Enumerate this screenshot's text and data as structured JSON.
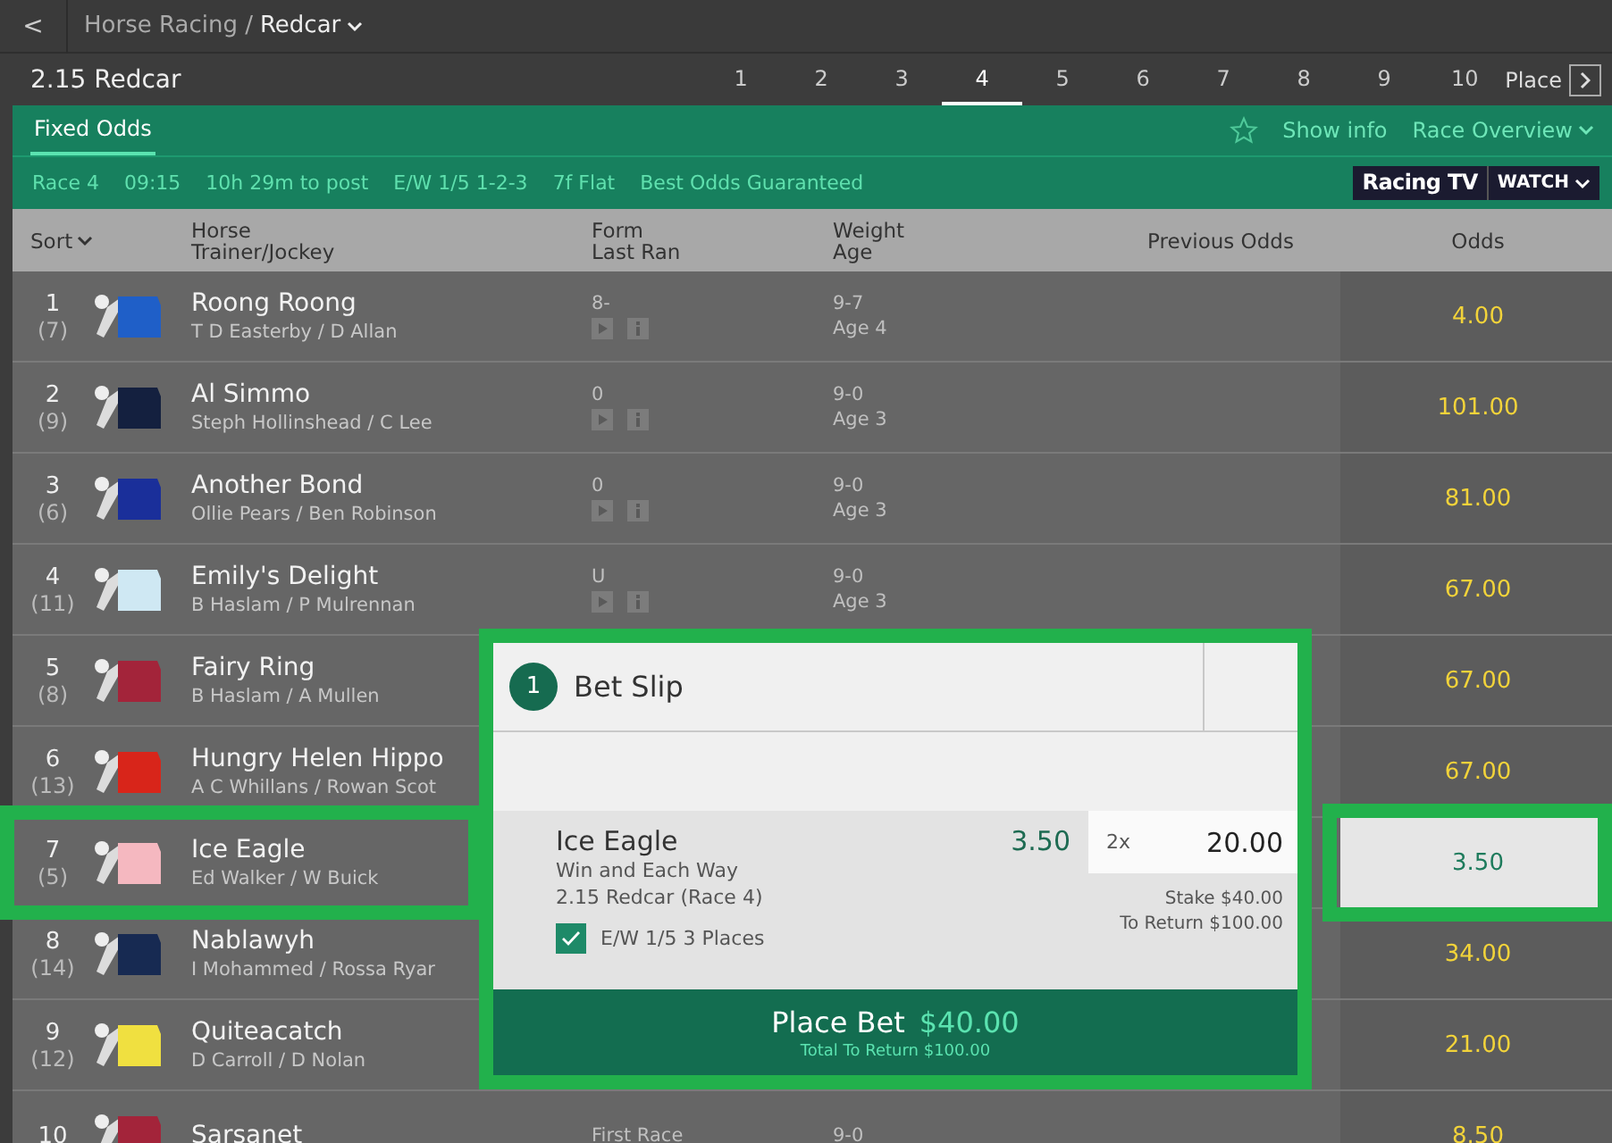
{
  "breadcrumb": {
    "back": "<",
    "section": "Horse Racing",
    "separator": "/",
    "current": "Redcar"
  },
  "race_title": "2.15 Redcar",
  "race_tabs": [
    {
      "label": "1",
      "selected": false
    },
    {
      "label": "2",
      "selected": false
    },
    {
      "label": "3",
      "selected": false
    },
    {
      "label": "4",
      "selected": true
    },
    {
      "label": "5",
      "selected": false
    },
    {
      "label": "6",
      "selected": false
    },
    {
      "label": "7",
      "selected": false
    },
    {
      "label": "8",
      "selected": false
    },
    {
      "label": "9",
      "selected": false
    },
    {
      "label": "10",
      "selected": false
    }
  ],
  "place_label": "Place",
  "market_tabs": [
    {
      "label": "Fixed Odds",
      "selected": true
    }
  ],
  "show_info": "Show info",
  "race_overview": "Race Overview",
  "race_info": [
    "Race 4",
    "09:15",
    "10h 29m to post",
    "E/W 1/5 1-2-3",
    "7f Flat",
    "Best Odds Guaranteed"
  ],
  "racing_tv": "Racing TV",
  "watch": "WATCH",
  "columns": {
    "sort": "Sort",
    "horse": "Horse",
    "trainer_jockey": "Trainer/Jockey",
    "form": "Form",
    "last_ran": "Last Ran",
    "weight": "Weight",
    "age": "Age",
    "previous_odds": "Previous Odds",
    "odds": "Odds"
  },
  "runners": [
    {
      "number": "1",
      "draw": "(7)",
      "name": "Roong Roong",
      "trainer_jockey": "T D Easterby / D Allan",
      "form": "8-",
      "weight": "9-7",
      "age": "Age 4",
      "odds": "4.00",
      "color": "#1f5fc8",
      "selected": false,
      "form_icons": true
    },
    {
      "number": "2",
      "draw": "(9)",
      "name": "Al Simmo",
      "trainer_jockey": "Steph Hollinshead / C Lee",
      "form": "0",
      "weight": "9-0",
      "age": "Age 3",
      "odds": "101.00",
      "color": "#14203f",
      "selected": false,
      "form_icons": true
    },
    {
      "number": "3",
      "draw": "(6)",
      "name": "Another Bond",
      "trainer_jockey": "Ollie Pears / Ben Robinson",
      "form": "0",
      "weight": "9-0",
      "age": "Age 3",
      "odds": "81.00",
      "color": "#1a2f9a",
      "selected": false,
      "form_icons": true
    },
    {
      "number": "4",
      "draw": "(11)",
      "name": "Emily's Delight",
      "trainer_jockey": "B Haslam / P Mulrennan",
      "form": "U",
      "weight": "9-0",
      "age": "Age 3",
      "odds": "67.00",
      "color": "#cfe8f3",
      "selected": false,
      "form_icons": true
    },
    {
      "number": "5",
      "draw": "(8)",
      "name": "Fairy Ring",
      "trainer_jockey": "B Haslam / A Mullen",
      "odds": "67.00",
      "color": "#a3243a",
      "selected": false,
      "form_icons": false
    },
    {
      "number": "6",
      "draw": "(13)",
      "name": "Hungry Helen Hippo",
      "trainer_jockey": "A C Whillans / Rowan Scot",
      "odds": "67.00",
      "color": "#d8251a",
      "selected": false,
      "form_icons": false
    },
    {
      "number": "7",
      "draw": "(5)",
      "name": "Ice Eagle",
      "trainer_jockey": "Ed Walker / W Buick",
      "odds": "3.50",
      "color": "#f5b8c0",
      "selected": true,
      "form_icons": false
    },
    {
      "number": "8",
      "draw": "(14)",
      "name": "Nablawyh",
      "trainer_jockey": "I Mohammed / Rossa Ryar",
      "odds": "34.00",
      "color": "#172a52",
      "selected": false,
      "form_icons": false
    },
    {
      "number": "9",
      "draw": "(12)",
      "name": "Quiteacatch",
      "trainer_jockey": "D Carroll / D Nolan",
      "odds": "21.00",
      "color": "#f0e040",
      "selected": false,
      "form_icons": false
    },
    {
      "number": "10",
      "name": "Sarsanet",
      "form": "First Race",
      "weight": "9-0",
      "odds": "8.50",
      "color": "#a3243a",
      "selected": false,
      "form_icons": false
    }
  ],
  "bet_slip": {
    "count": "1",
    "title": "Bet Slip",
    "selection": "Ice Eagle",
    "bet_type": "Win and Each Way",
    "race": "2.15 Redcar (Race 4)",
    "odds": "3.50",
    "multiplier": "2x",
    "stake_value": "20.00",
    "stake": "Stake $40.00",
    "to_return": "To Return $100.00",
    "each_way": {
      "label": "E/W 1/5 3 Places",
      "checked": true
    },
    "place_bet": "Place Bet",
    "place_amount": "$40.00",
    "total_return": "Total To Return $100.00"
  }
}
